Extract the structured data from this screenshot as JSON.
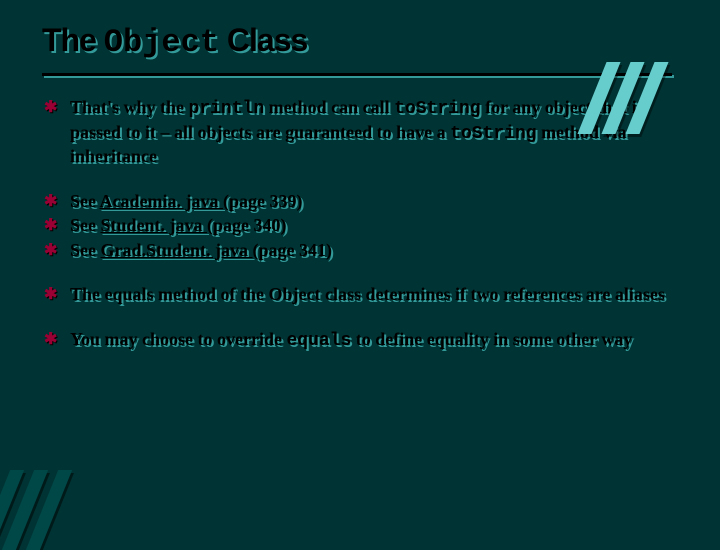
{
  "title": {
    "pre": "The ",
    "mono": "Object",
    "post": " Class"
  },
  "bullets": {
    "b1": {
      "p1": "That's why the ",
      "c1": "println",
      "p2": " method can call ",
      "c2": "toString",
      "p3": " for any object that is passed to it – all objects are guaranteed to have a ",
      "c3": "toString",
      "p4": " method via inheritance"
    },
    "b2": {
      "pre": "See ",
      "link": "Academia. java ",
      "post": "(page 339)"
    },
    "b3": {
      "pre": "See ",
      "link": "Student. java ",
      "post": "(page 340)"
    },
    "b4": {
      "pre": "See ",
      "link": "Grad.Student. java ",
      "post": "(page 341)"
    },
    "b5": "The equals method of the Object class determines if two references are aliases",
    "b6": {
      "p1": "You may choose to override ",
      "c1": "equals",
      "p2": " to define equality in some other way"
    }
  }
}
